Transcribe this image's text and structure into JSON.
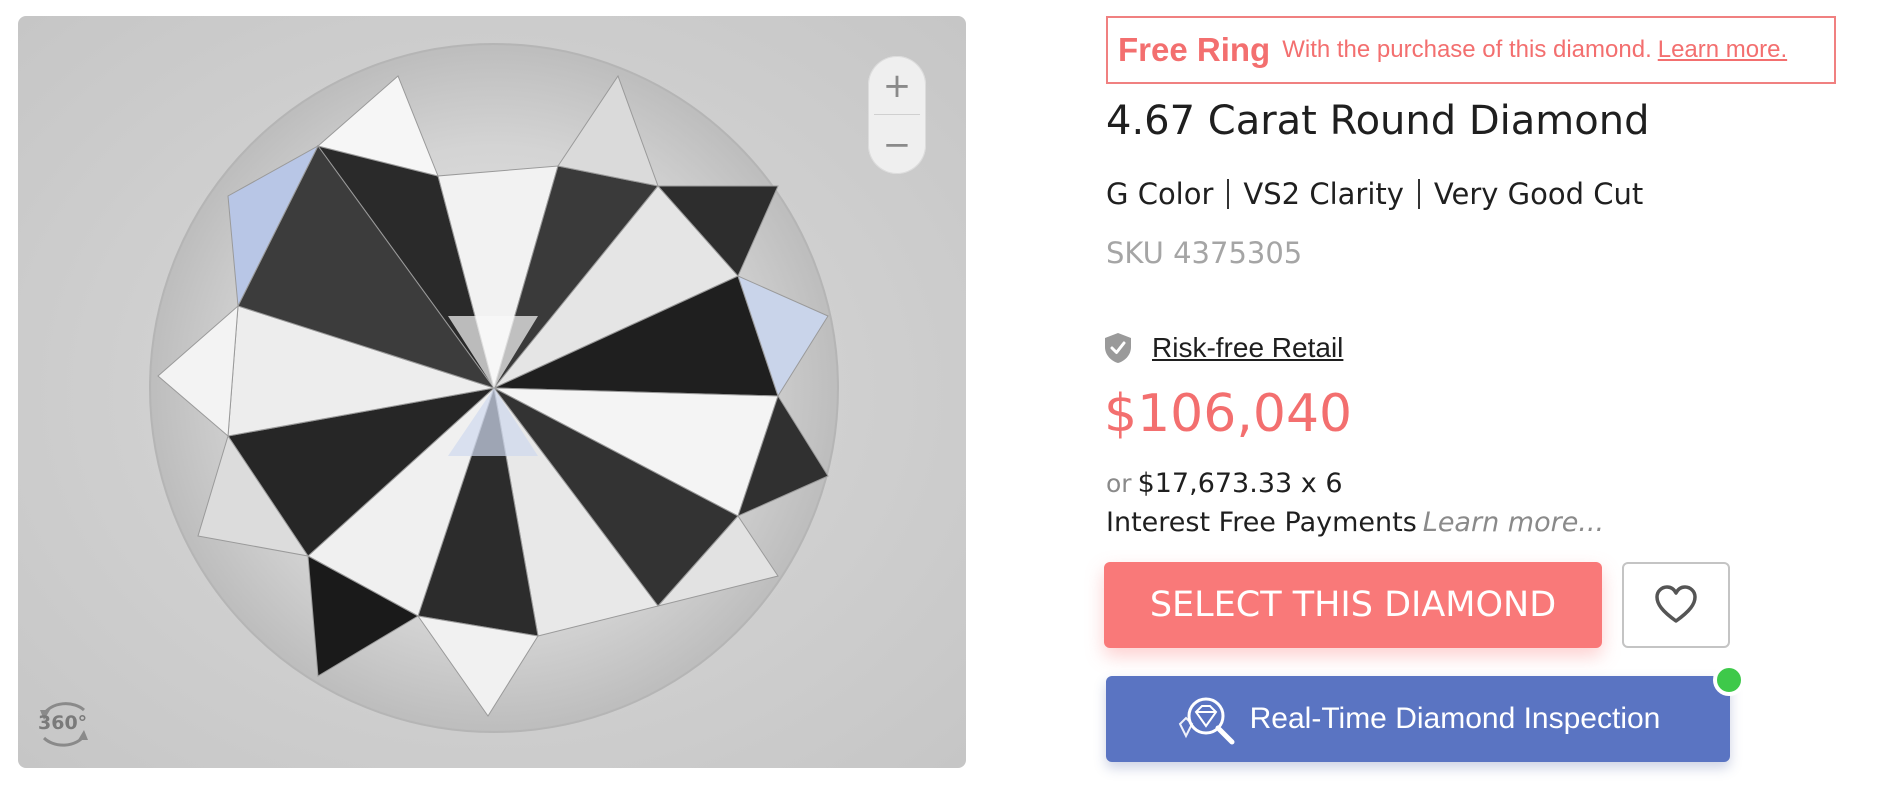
{
  "viewer": {
    "zoom_in": "+",
    "zoom_out": "−",
    "spin_label": "360°"
  },
  "promo": {
    "title": "Free Ring",
    "description": "With the purchase of this diamond.",
    "link": "Learn more."
  },
  "product": {
    "title": "4.67 Carat Round Diamond",
    "color": "G Color",
    "clarity": "VS2 Clarity",
    "cut": "Very Good Cut",
    "sku": "SKU 4375305"
  },
  "retail": {
    "label": "Risk-free Retail",
    "icon": "shield-check-icon"
  },
  "pricing": {
    "price": "$106,040",
    "or": "or",
    "installment": "$17,673.33 x 6",
    "interest_text": "Interest Free Payments",
    "interest_link": "Learn more..."
  },
  "actions": {
    "select_label": "SELECT THIS DIAMOND",
    "wishlist_icon": "heart-icon",
    "inspection_label": "Real-Time Diamond Inspection",
    "inspection_icon": "diamond-magnifier-icon"
  },
  "colors": {
    "accent": "#f97979",
    "price": "#f36f6f",
    "inspection": "#5a74c2",
    "online": "#3ec94a"
  }
}
